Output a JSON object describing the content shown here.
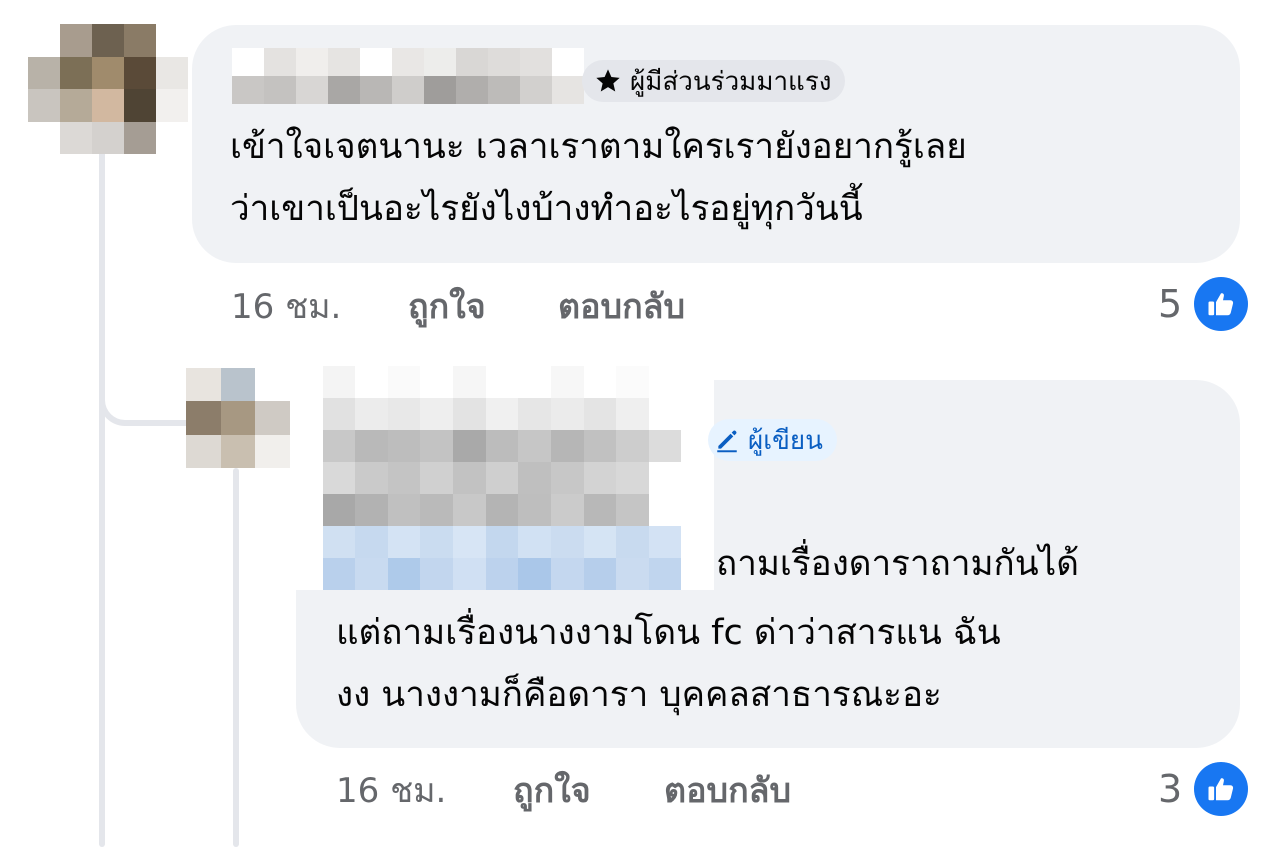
{
  "comments": [
    {
      "badge": "ผู้มีส่วนร่วมมาแรง",
      "text_lines": [
        "เข้าใจเจตนานะ เวลาเราตามใครเรายังอยากรู้เลย",
        "ว่าเขาเป็นอะไรยังไงบ้างทำอะไรอยู่ทุกวันนี้"
      ],
      "time": "16 ชม.",
      "like_label": "ถูกใจ",
      "reply_label": "ตอบกลับ",
      "reaction_count": "5",
      "badge_icon": "star-icon",
      "reaction_icon": "thumbs-up-icon"
    },
    {
      "badge": "ผู้เขียน",
      "text_lines": [
        "ถามเรื่องดาราถามกันได้",
        "แต่ถามเรื่องนางงามโดน fc ด่าว่าสารแน ฉัน",
        "งง นางงามก็คือดารา บุคคลสาธารณะอะ"
      ],
      "time": "16 ชม.",
      "like_label": "ถูกใจ",
      "reply_label": "ตอบกลับ",
      "reaction_count": "3",
      "badge_icon": "pencil-icon",
      "reaction_icon": "thumbs-up-icon"
    }
  ],
  "colors": {
    "bubble": "#f0f2f5",
    "meta_text": "#65676b",
    "author_badge_bg": "#e7f3ff",
    "author_badge_text": "#0a5ec2",
    "like_blue": "#1877f2",
    "thread_line": "#e4e6eb"
  }
}
